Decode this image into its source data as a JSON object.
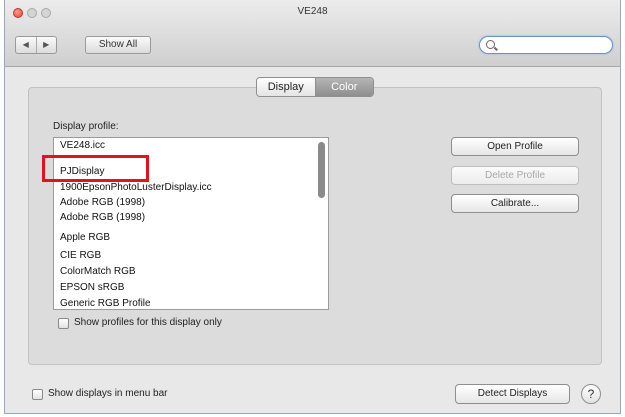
{
  "window": {
    "title": "VE248"
  },
  "toolbar": {
    "back_glyph": "◀",
    "forward_glyph": "▶",
    "show_all_label": "Show All",
    "search_placeholder": ""
  },
  "tabs": [
    {
      "label": "Display",
      "selected": false
    },
    {
      "label": "Color",
      "selected": true
    }
  ],
  "profile_section": {
    "label": "Display profile:",
    "profiles": [
      "VE248.icc",
      "PJDisplay",
      "1900EpsonPhotoLusterDisplay.icc",
      "Adobe RGB (1998)",
      "Adobe RGB (1998)",
      "Apple RGB",
      "CIE RGB",
      "ColorMatch RGB",
      "EPSON sRGB",
      "Generic RGB Profile"
    ],
    "show_only_label": "Show profiles for this display only"
  },
  "buttons": {
    "open_profile": "Open Profile",
    "delete_profile": "Delete Profile",
    "calibrate": "Calibrate..."
  },
  "footer": {
    "show_in_menu_label": "Show displays in menu bar",
    "detect_displays": "Detect Displays",
    "help_glyph": "?"
  },
  "colors": {
    "highlight_box": "#e3121d",
    "search_focus": "#6d8fd0",
    "selected_tab": "#9c9c9c"
  }
}
